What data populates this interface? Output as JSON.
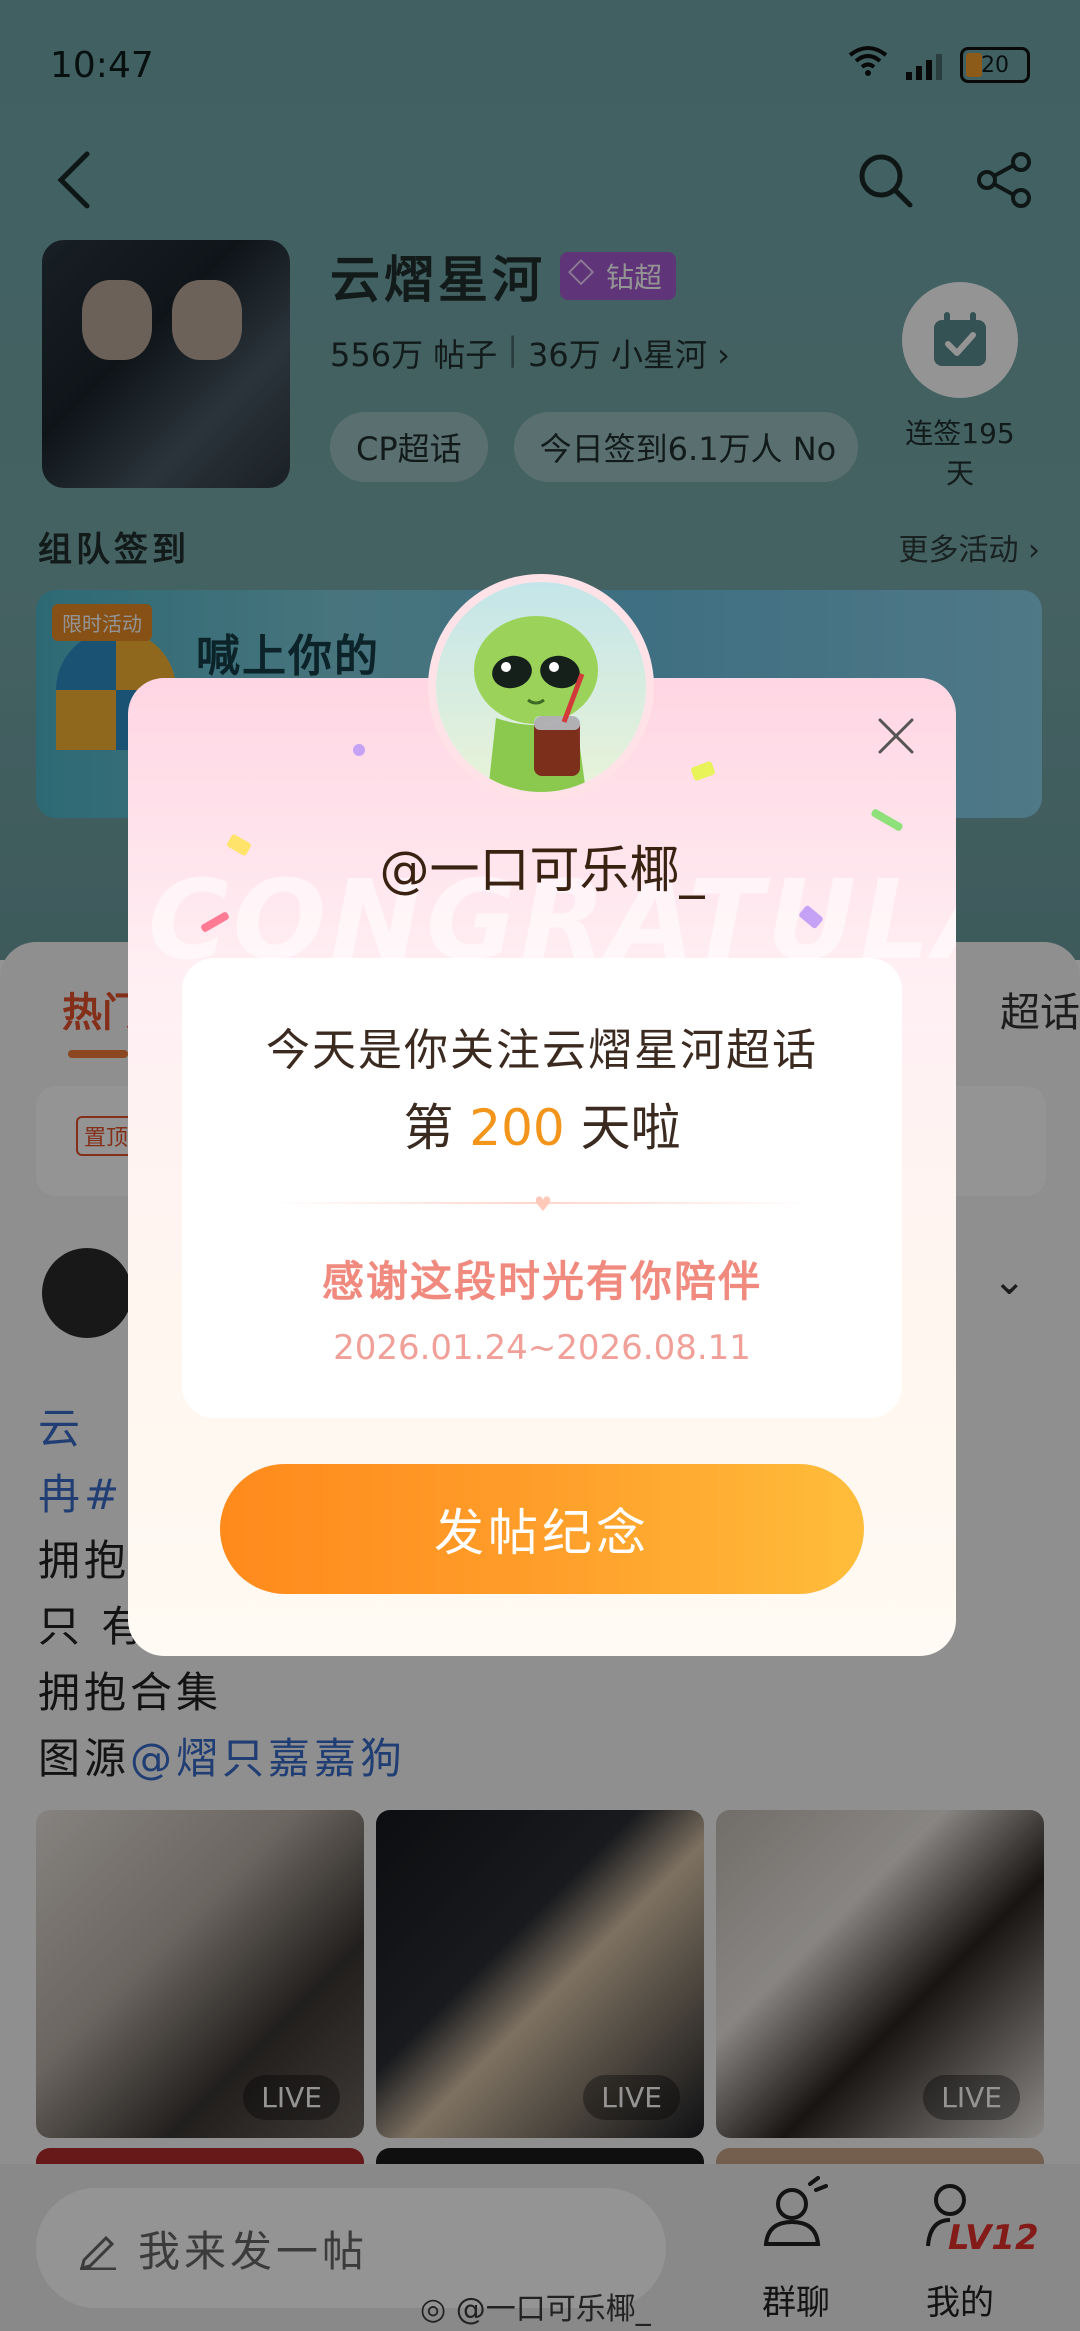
{
  "status_bar": {
    "time": "10:47",
    "battery": "20"
  },
  "header": {
    "back_icon": "chevron-left-icon",
    "search_icon": "search-icon",
    "share_icon": "share-icon"
  },
  "topic": {
    "title": "云熠星河",
    "badge": "钻超",
    "posts_count": "556万 帖子",
    "followers": "36万 小星河 ›",
    "chips": [
      "CP超话",
      "今日签到6.1万人 No"
    ],
    "checkin_label": "连签195天"
  },
  "section": {
    "heading": "组队签到",
    "more": "更多活动 ›"
  },
  "banner": {
    "tag": "限时活动",
    "text": "喊上你的"
  },
  "tabs": {
    "active": "热门",
    "right": "超话"
  },
  "pinned": {
    "tag": "置顶"
  },
  "post": {
    "lines": [
      "云",
      "冉#",
      "拥抱",
      "只 有",
      "拥抱合集"
    ],
    "credit_prefix": "图源",
    "credit_mention": "@熠只嘉嘉狗"
  },
  "photos": [
    {
      "live": "LIVE"
    },
    {
      "live": "LIVE"
    },
    {
      "live": "LIVE"
    }
  ],
  "bottom": {
    "compose_placeholder": "我来发一帖",
    "group_chat": "群聊",
    "mine": "我的",
    "level": "LV12",
    "watermark": "@一口可乐椰_"
  },
  "modal": {
    "background_text": "CONGRATULATE",
    "username": "@一口可乐椰_",
    "message_line1": "今天是你关注云熠星河超话",
    "message_prefix": "第",
    "day_count": "200",
    "message_suffix": "天啦",
    "thanks": "感谢这段时光有你陪伴",
    "date_range": "2026.01.24~2026.08.11",
    "button": "发帖纪念"
  },
  "colors": {
    "accent_orange": "#f3941b",
    "button_gradient_start": "#ff8a1c",
    "button_gradient_end": "#ffbd3b",
    "thanks_pink": "#f08a7e",
    "badge_purple": "#a45ad0"
  }
}
